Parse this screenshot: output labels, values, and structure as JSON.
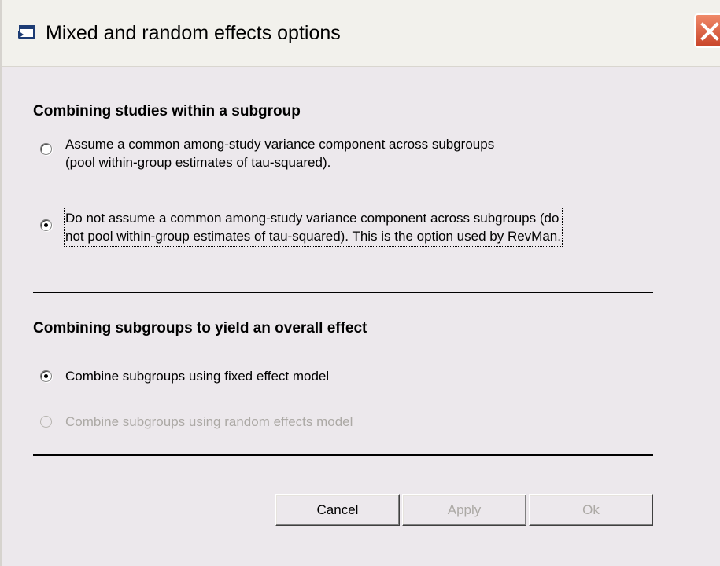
{
  "window": {
    "title": "Mixed and random effects options"
  },
  "section1": {
    "heading": "Combining studies within a subgroup",
    "option1": {
      "line1": "Assume a common among-study variance component across subgroups",
      "line2": "(pool within-group estimates of tau-squared).",
      "selected": false
    },
    "option2": {
      "line1": "Do not assume a common among-study variance component across subgroups (do",
      "line2": "not pool within-group estimates of tau-squared). This is the option used by RevMan.",
      "selected": true
    }
  },
  "section2": {
    "heading": "Combining subgroups to yield an overall effect",
    "option1": {
      "label": "Combine subgroups using fixed effect model",
      "selected": true
    },
    "option2": {
      "label": "Combine subgroups using random effects model",
      "selected": false,
      "disabled": true
    }
  },
  "buttons": {
    "cancel": "Cancel",
    "apply": "Apply",
    "ok": "Ok"
  },
  "colors": {
    "dialog_background": "#ece8ec",
    "close_button": "#c9452a",
    "disabled_text": "#aca9a5"
  },
  "icons": {
    "app": "window-icon",
    "close": "close-icon"
  }
}
